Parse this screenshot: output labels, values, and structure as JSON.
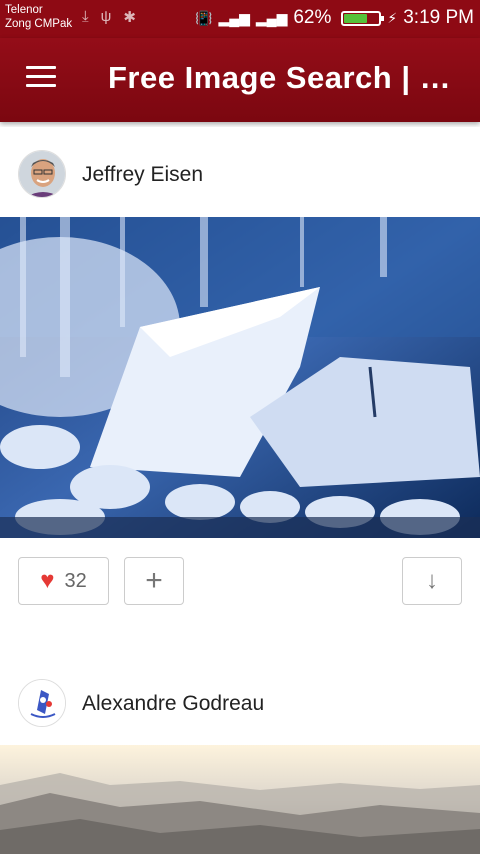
{
  "status_bar": {
    "carrier_1": "Telenor",
    "carrier_2": "Zong CMPak",
    "battery_percent": "62%",
    "time": "3:19 PM"
  },
  "app_bar": {
    "title": "Free Image Search | U..."
  },
  "posts": [
    {
      "author": "Jeffrey Eisen",
      "likes": "32"
    },
    {
      "author": "Alexandre Godreau"
    }
  ],
  "colors": {
    "primary": "#8e0a14",
    "heart": "#e53935",
    "battery": "#55c23a"
  }
}
